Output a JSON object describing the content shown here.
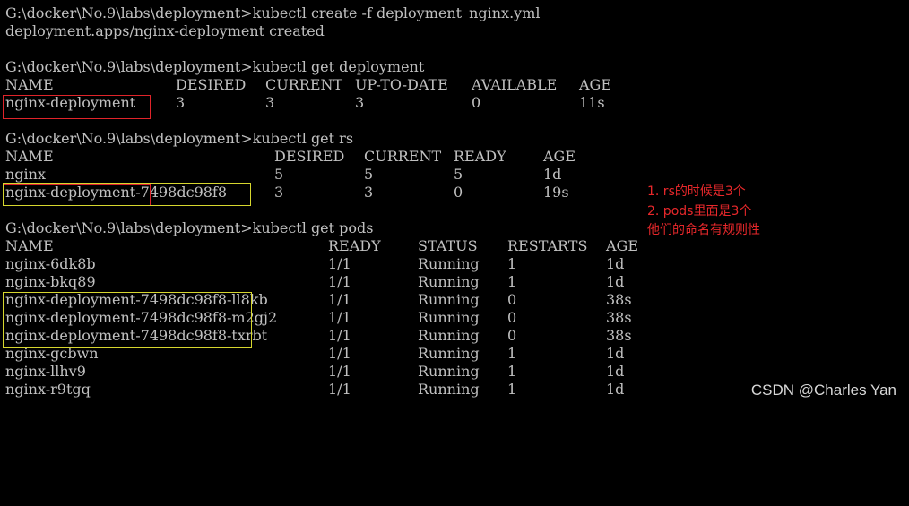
{
  "colors": {
    "background": "#000000",
    "text": "#c0c0c0",
    "red_annotation": "#e8282b",
    "red_box": "#e0242a",
    "yellow_box": "#d6d62e"
  },
  "terminal": {
    "cmd_create": "G:\\docker\\No.9\\labs\\deployment>kubectl create -f deployment_nginx.yml",
    "create_result": "deployment.apps/nginx-deployment created",
    "cmd_get_deployment": "G:\\docker\\No.9\\labs\\deployment>kubectl get deployment",
    "deployment_headers": [
      "NAME",
      "DESIRED",
      "CURRENT",
      "UP-TO-DATE",
      "AVAILABLE",
      "AGE"
    ],
    "deployment_rows": [
      [
        "nginx-deployment",
        "3",
        "3",
        "3",
        "0",
        "11s"
      ]
    ],
    "cmd_get_rs": "G:\\docker\\No.9\\labs\\deployment>kubectl get rs",
    "rs_headers": [
      "NAME",
      "DESIRED",
      "CURRENT",
      "READY",
      "AGE"
    ],
    "rs_rows": [
      [
        "nginx",
        "5",
        "5",
        "5",
        "1d"
      ],
      [
        "nginx-deployment-7498dc98f8",
        "3",
        "3",
        "0",
        "19s"
      ]
    ],
    "cmd_get_pods": "G:\\docker\\No.9\\labs\\deployment>kubectl get pods",
    "pods_headers": [
      "NAME",
      "READY",
      "STATUS",
      "RESTARTS",
      "AGE"
    ],
    "pods_rows": [
      [
        "nginx-6dk8b",
        "1/1",
        "Running",
        "1",
        "1d"
      ],
      [
        "nginx-bkq89",
        "1/1",
        "Running",
        "1",
        "1d"
      ],
      [
        "nginx-deployment-7498dc98f8-ll8kb",
        "1/1",
        "Running",
        "0",
        "38s"
      ],
      [
        "nginx-deployment-7498dc98f8-m2gj2",
        "1/1",
        "Running",
        "0",
        "38s"
      ],
      [
        "nginx-deployment-7498dc98f8-txrbt",
        "1/1",
        "Running",
        "0",
        "38s"
      ],
      [
        "nginx-gcbwn",
        "1/1",
        "Running",
        "1",
        "1d"
      ],
      [
        "nginx-llhv9",
        "1/1",
        "Running",
        "1",
        "1d"
      ],
      [
        "nginx-r9tgq",
        "1/1",
        "Running",
        "1",
        "1d"
      ]
    ]
  },
  "annotation": {
    "line1": "1. rs的时候是3个",
    "line2": "2. pods里面是3个",
    "line3": "他们的命名有规则性"
  },
  "watermark": "CSDN @Charles Yan"
}
